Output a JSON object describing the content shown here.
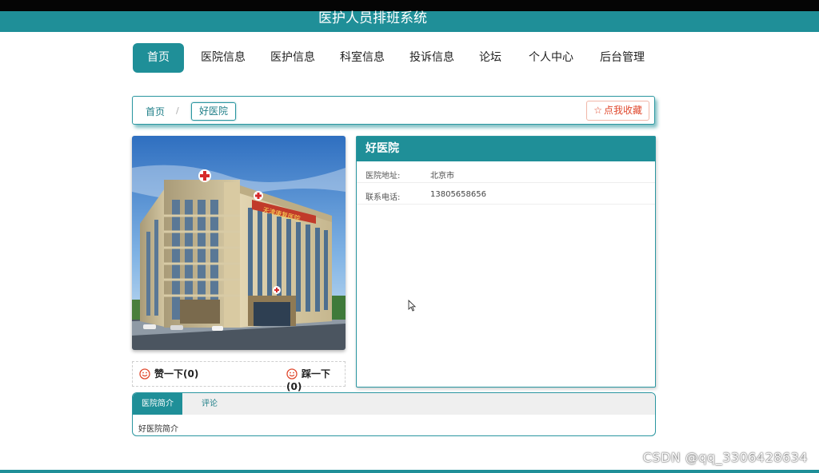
{
  "header": {
    "title": "医护人员排班系统"
  },
  "nav": {
    "items": [
      {
        "label": "首页"
      },
      {
        "label": "医院信息"
      },
      {
        "label": "医护信息"
      },
      {
        "label": "科室信息"
      },
      {
        "label": "投诉信息"
      },
      {
        "label": "论坛"
      },
      {
        "label": "个人中心"
      },
      {
        "label": "后台管理"
      }
    ],
    "active_index": 0
  },
  "breadcrumb": {
    "home": "首页",
    "separator": "/",
    "current": "好医院"
  },
  "favorite_button": {
    "label": "点我收藏",
    "icon": "star-outline-icon"
  },
  "hospital_image": {
    "sign_text": "天津康复医院"
  },
  "votes": {
    "like_label": "赞一下(0)",
    "like_icon": "smile-icon",
    "dislike_label": "踩一下(0)",
    "dislike_icon": "smile-icon"
  },
  "info_panel": {
    "title": "好医院",
    "rows": [
      {
        "label": "医院地址:",
        "value": "北京市"
      },
      {
        "label": "联系电话:",
        "value": "13805658656"
      }
    ]
  },
  "tabs": {
    "items": [
      {
        "label": "医院简介"
      },
      {
        "label": "评论"
      }
    ],
    "active_index": 0,
    "content": "好医院简介"
  },
  "watermark": "CSDN @qq_3306428634",
  "colors": {
    "primary": "#1f8f98",
    "favorite": "#e0492e",
    "vote_icon": "#e0492e"
  }
}
